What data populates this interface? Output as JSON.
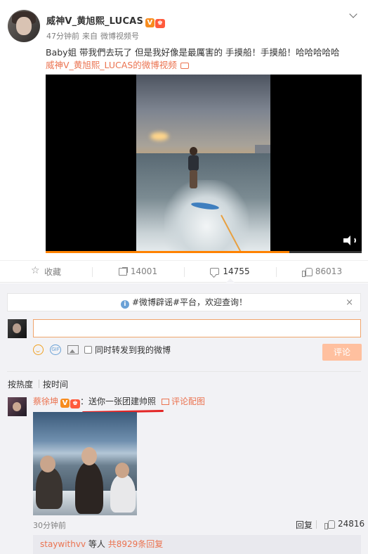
{
  "post": {
    "author": "威神V_黄旭熙_LUCAS",
    "verified_badge": "V",
    "crown_badge": "♚",
    "time": "47分钟前",
    "source_prefix": "来自",
    "source": "微博视频号",
    "text": "Baby姐 带我們去玩了 但是我好像是最厲害的 手摸船！手摸船！哈哈哈哈哈",
    "video_link": "威神V_黄旭熙_LUCAS的微博视频",
    "video_progress_percent": 77
  },
  "actions": {
    "favorite": "收藏",
    "repost": "14001",
    "comment": "14755",
    "like": "86013"
  },
  "notice": {
    "text": "#微博辟谣#平台，欢迎查询！",
    "close": "×"
  },
  "composer": {
    "sync_label": "同时转发到我的微博",
    "submit": "评论",
    "gif_label": "GIF"
  },
  "sort": {
    "hot": "按热度",
    "time": "按时间"
  },
  "comment": {
    "author": "蔡徐坤",
    "verified_badge": "V",
    "crown_badge": "♚",
    "colon": "：",
    "text": "送你一张团建帅照",
    "pic_link": "评论配图",
    "time": "30分钟前",
    "reply": "回复",
    "likes": "24816",
    "reply_user": "staywithvv",
    "reply_middle": "等人",
    "reply_count": "共8929条回复"
  },
  "colors": {
    "accent": "#eb7350",
    "progress": "#ff8200",
    "comment_bg": "#f2f2f5",
    "annotation_underline": "#e32525"
  }
}
